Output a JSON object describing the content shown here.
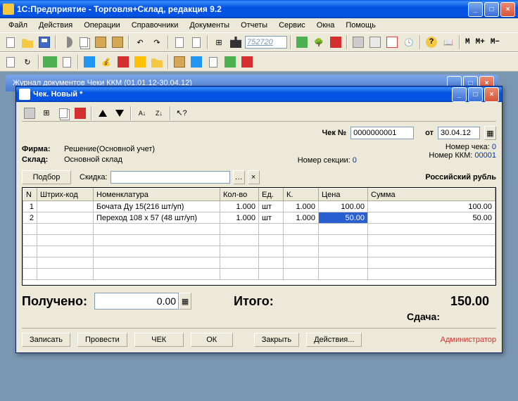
{
  "app": {
    "title": "1С:Предприятие - Торговля+Склад, редакция 9.2"
  },
  "menu": {
    "file": "Файл",
    "actions": "Действия",
    "operations": "Операции",
    "refs": "Справочники",
    "docs": "Документы",
    "reports": "Отчеты",
    "service": "Сервис",
    "windows": "Окна",
    "help": "Помощь"
  },
  "toolbar": {
    "search_value": "752720",
    "m": "M",
    "mplus": "M+",
    "mminus": "M−"
  },
  "mdi": {
    "behind_title": "Журнал документов Чеки ККМ (01.01.12-30.04.12)"
  },
  "dialog": {
    "title": "Чек. Новый *",
    "check_no_label": "Чек №",
    "check_no": "0000000001",
    "date_label": "от",
    "date": "30.04.12",
    "firm_label": "Фирма:",
    "firm_value": "Решение(Основной учет)",
    "sklad_label": "Склад:",
    "sklad_value": "Основной склад",
    "section_label": "Номер секции:",
    "section_value": "0",
    "check_num_label": "Номер чека:",
    "check_num_value": "0",
    "kkm_label": "Номер ККМ:",
    "kkm_value": "00001",
    "podbor": "Подбор",
    "skidka": "Скидка:",
    "currency": "Российский рубль",
    "cols": {
      "n": "N",
      "barcode": "Штрих-код",
      "nomen": "Номенклатура",
      "qty": "Кол-во",
      "unit": "Ед.",
      "k": "К.",
      "price": "Цена",
      "sum": "Сумма"
    },
    "rows": [
      {
        "n": "1",
        "barcode": "",
        "nomen": "Бочата Ду 15(216 шт/уп)",
        "qty": "1.000",
        "unit": "шт",
        "k": "1.000",
        "price": "100.00",
        "sum": "100.00"
      },
      {
        "n": "2",
        "barcode": "",
        "nomen": "Переход 108 x 57 (48 шт/уп)",
        "qty": "1.000",
        "unit": "шт",
        "k": "1.000",
        "price": "50.00",
        "sum": "50.00"
      }
    ],
    "received_label": "Получено:",
    "received_value": "0.00",
    "total_label": "Итого:",
    "total_value": "150.00",
    "change_label": "Сдача:",
    "buttons": {
      "write": "Записать",
      "post": "Провести",
      "check": "ЧЕК",
      "ok": "ОК",
      "close": "Закрыть",
      "actions": "Действия...",
      "admin": "Администратор"
    }
  }
}
